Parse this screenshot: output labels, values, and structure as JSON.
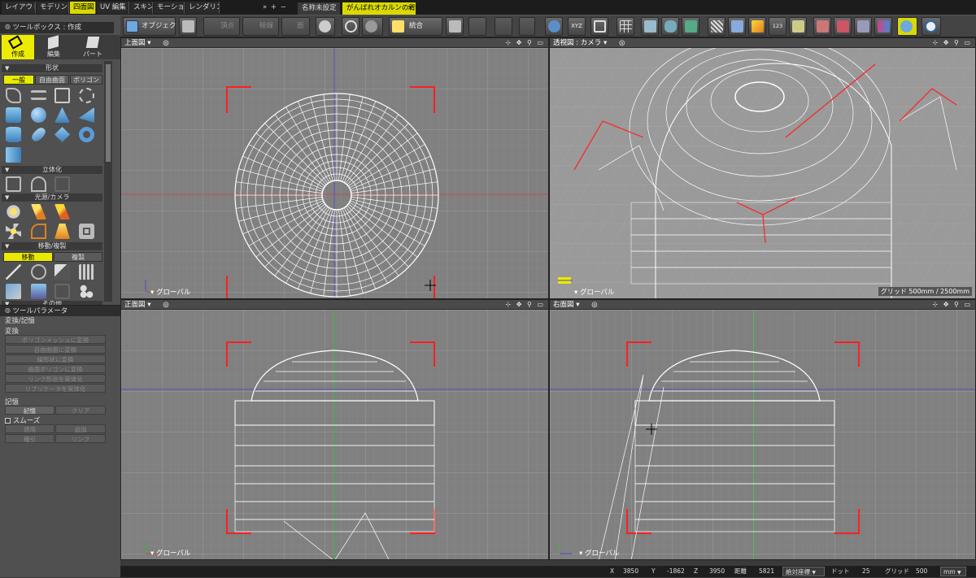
{
  "app": {
    "mode_tabs": [
      "レイアウト",
      "モデリング",
      "四面図",
      "UV 編集",
      "スキン",
      "モーション",
      "レンダリング"
    ],
    "tab_arrows": "» +  −",
    "file_tabs": [
      "名称未設定",
      "がんばれオカルンの背…"
    ],
    "file_close": "×"
  },
  "toolbar": {
    "object_label": "オブジェクト",
    "vertex_label": "頂点",
    "edge_label": "稜線",
    "face_label": "面",
    "merge_label": "統合",
    "xyz_label": "XYZ",
    "num_label": "123"
  },
  "toolbox": {
    "title": "ツールボックス : 作成",
    "tabs": [
      "作成",
      "編集",
      "パート"
    ],
    "sections": {
      "shape": "形状",
      "solidify": "立体化",
      "light_camera": "光源/カメラ",
      "move_copy": "移動/複製",
      "other": "その他"
    },
    "shape_subtabs": [
      "一般",
      "自由曲面",
      "ポリゴン"
    ],
    "move_subtabs": [
      "移動",
      "複製"
    ]
  },
  "toolparam": {
    "title": "ツールパラメータ",
    "subtitle": "変換/記憶",
    "convert_label": "変換",
    "convert_buttons": [
      "ポリゴンメッシュに変換",
      "自由曲面に変換",
      "線形状に変換",
      "曲面ポリゴンに変換",
      "リンク形状を実体化",
      "リプリケータを実体化"
    ],
    "memory_label": "記憶",
    "memory_buttons": [
      "記憶",
      "クリア"
    ],
    "smooth_label": "スムーズ",
    "apply_buttons": [
      "適用",
      "追加"
    ],
    "link_buttons": [
      "種引",
      "リンク"
    ]
  },
  "viewports": {
    "top": {
      "title": "上面図",
      "axis_label": "グローバル"
    },
    "persp": {
      "title": "透視図 : カメラ",
      "axis_label": "グローバル",
      "grid_info": "グリッド 500mm / 2500mm"
    },
    "front": {
      "title": "正面図",
      "axis_label": "グローバル"
    },
    "right": {
      "title": "右面図",
      "axis_label": "グローバル"
    },
    "header_icons": "⊹ ✥ ⚲ ▭"
  },
  "statusbar": {
    "x_label": "X",
    "x_value": "3850",
    "y_label": "Y",
    "y_value": "-1862",
    "z_label": "Z",
    "z_value": "3950",
    "dist_label": "距離",
    "dist_value": "5821",
    "coord_mode": "絶対座標",
    "dot_label": "ドット",
    "dot_value": "25",
    "grid_label": "グリッド",
    "grid_value": "500",
    "unit": "mm"
  },
  "colors": {
    "accent": "#e8e800",
    "viewport_bg": "#808080",
    "persp_bg": "#9a9a9a",
    "wire": "#ffffff",
    "frame_red": "#ff2020"
  }
}
